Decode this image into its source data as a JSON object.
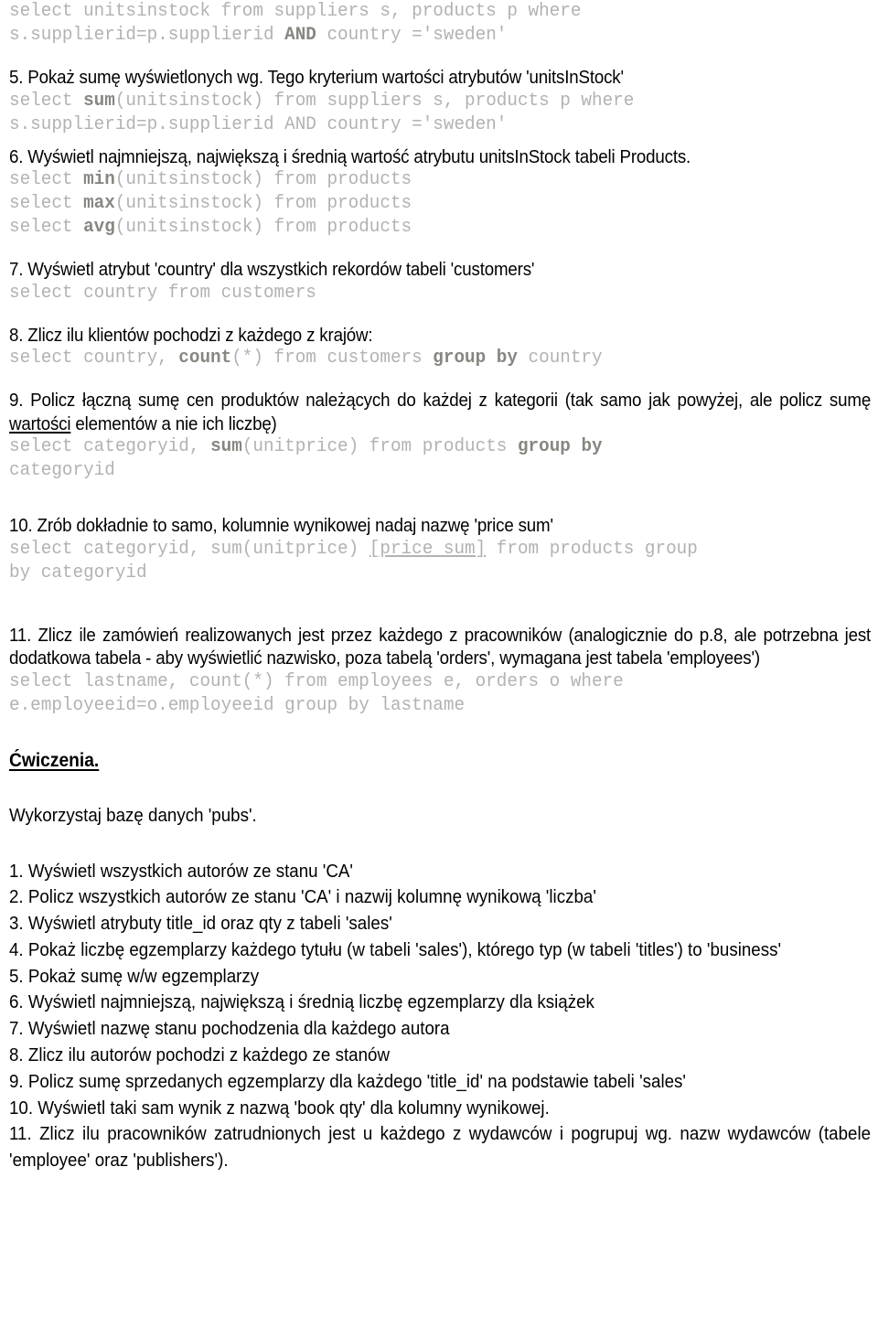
{
  "document": {
    "language": "pl",
    "blocks": [
      {
        "type": "code",
        "id": "code_q4_cont",
        "lines": [
          "select unitsinstock from suppliers s, products p where",
          "s.supplierid=p.supplierid <b>AND</b> country ='sweden'"
        ]
      },
      {
        "type": "question",
        "id": "q5",
        "text": "5. Pokaż sumę wyświetlonych wg. Tego kryterium wartości atrybutów 'unitsInStock'"
      },
      {
        "type": "code",
        "id": "code_q5",
        "lines": [
          "select <b>sum</b>(unitsinstock) from suppliers s, products p where",
          "s.supplierid=p.supplierid AND country ='sweden'"
        ]
      },
      {
        "type": "question",
        "id": "q6",
        "text": "6. Wyświetl najmniejszą, największą i średnią wartość atrybutu unitsInStock tabeli Products."
      },
      {
        "type": "code",
        "id": "code_q6",
        "lines": [
          "select <b>min</b>(unitsinstock) from products",
          "select <b>max</b>(unitsinstock) from products",
          "select <b>avg</b>(unitsinstock) from products"
        ]
      },
      {
        "type": "question",
        "id": "q7",
        "text": "7. Wyświetl atrybut 'country' dla wszystkich rekordów tabeli 'customers'"
      },
      {
        "type": "code",
        "id": "code_q7",
        "lines": [
          "select country from customers"
        ]
      },
      {
        "type": "question",
        "id": "q8",
        "text": "8. Zlicz ilu klientów pochodzi z każdego z krajów:"
      },
      {
        "type": "code",
        "id": "code_q8",
        "lines": [
          "select country, <b>count</b>(*) from customers <b>group by</b> country"
        ]
      },
      {
        "type": "question",
        "id": "q9",
        "text": "9. Policz łączną sumę cen produktów należących do każdej z kategorii (tak samo jak powyżej, ale policz sumę <u>wartości</u> elementów a nie ich liczbę)"
      },
      {
        "type": "code",
        "id": "code_q9",
        "lines": [
          "select categoryid, <b>sum</b>(unitprice) from products <b>group by</b>",
          "categoryid"
        ]
      },
      {
        "type": "question",
        "id": "q10",
        "text": "10. Zrób dokładnie to samo, kolumnie wynikowej nadaj nazwę 'price sum'"
      },
      {
        "type": "code",
        "id": "code_q10",
        "lines": [
          "select categoryid, sum(unitprice) <u>[price sum]</u> from products group",
          "by categoryid"
        ]
      },
      {
        "type": "question",
        "id": "q11",
        "text": "11. Zlicz ile zamówień realizowanych jest przez każdego z pracowników (analogicznie do p.8, ale potrzebna jest dodatkowa tabela - aby wyświetlić nazwisko, poza tabelą 'orders', wymagana jest tabela 'employees')"
      },
      {
        "type": "code",
        "id": "code_q11",
        "lines": [
          "select lastname, count(*) from employees e, orders o where",
          "e.employeeid=o.employeeid group by lastname"
        ]
      }
    ],
    "exercises_section": {
      "title": "Ćwiczenia.",
      "intro": "Wykorzystaj bazę danych 'pubs'.",
      "items": [
        "1. Wyświetl wszystkich autorów ze stanu 'CA'",
        "2. Policz wszystkich autorów ze stanu 'CA' i nazwij kolumnę wynikową 'liczba'",
        "3. Wyświetl atrybuty title_id oraz qty z tabeli 'sales'",
        "4. Pokaż liczbę egzemplarzy każdego tytułu (w tabeli 'sales'), którego typ (w tabeli 'titles') to 'business'",
        "5. Pokaż sumę w/w egzemplarzy",
        "6. Wyświetl najmniejszą, największą i średnią liczbę egzemplarzy dla książek",
        "7. Wyświetl nazwę stanu pochodzenia dla każdego autora",
        "8. Zlicz ilu autorów pochodzi z każdego ze stanów",
        "9. Policz sumę sprzedanych egzemplarzy dla każdego 'title_id' na podstawie tabeli 'sales'",
        "10. Wyświetl taki sam wynik z nazwą 'book qty' dla kolumny wynikowej.",
        "11. Zlicz ilu pracowników zatrudnionych jest u każdego z wydawców i pogrupuj wg. nazw wydawców (tabele 'employee' oraz 'publishers')."
      ]
    },
    "colors": {
      "code_text": "#b2b2b2",
      "code_keyword": "#878781",
      "prose_text": "#000000",
      "page_background": "#ffffff"
    }
  }
}
